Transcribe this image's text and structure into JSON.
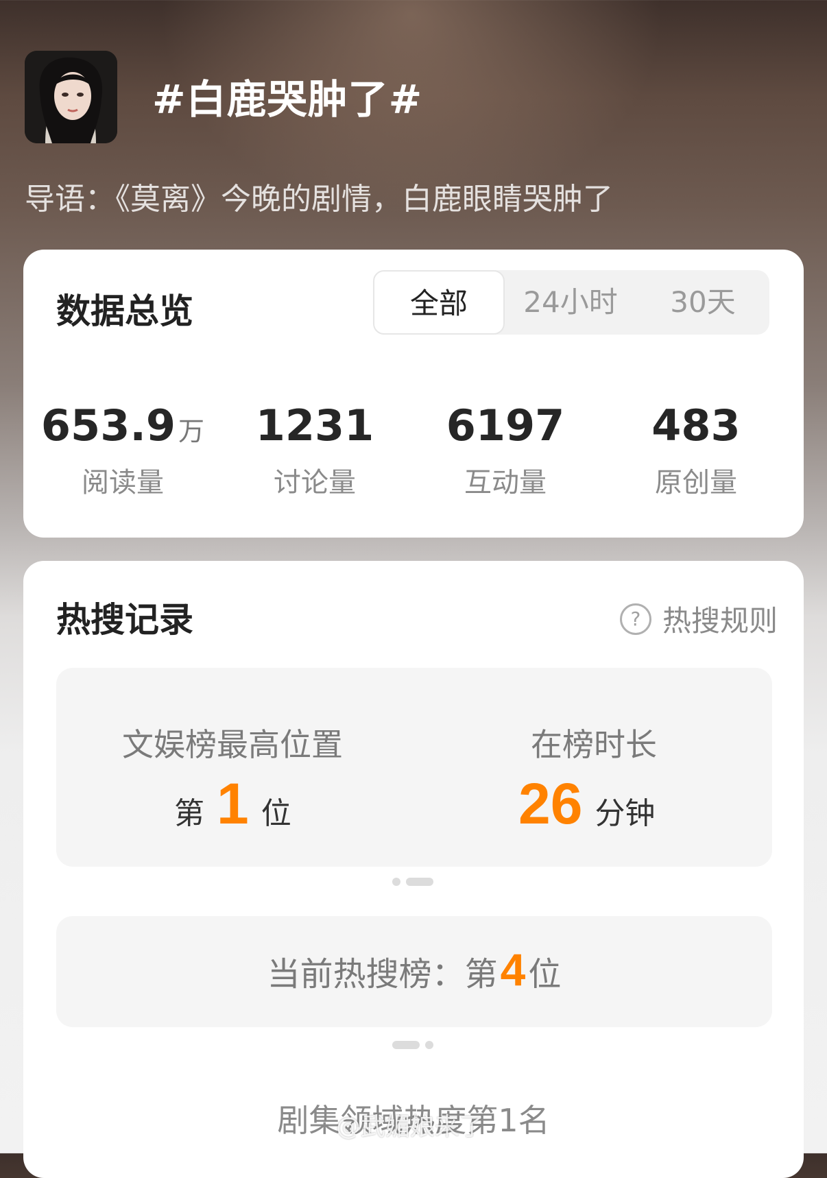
{
  "topic": {
    "title": "#白鹿哭肿了#",
    "intro": "导语：《莫离》今晚的剧情，白鹿眼睛哭肿了"
  },
  "overview": {
    "title": "数据总览",
    "tabs": [
      "全部",
      "24小时",
      "30天"
    ],
    "active_tab": "全部",
    "stats": [
      {
        "value": "653.9",
        "unit": "万",
        "label": "阅读量"
      },
      {
        "value": "1231",
        "unit": "",
        "label": "讨论量"
      },
      {
        "value": "6197",
        "unit": "",
        "label": "互动量"
      },
      {
        "value": "483",
        "unit": "",
        "label": "原创量"
      }
    ]
  },
  "hot_record": {
    "title": "热搜记录",
    "rules_label": "热搜规则",
    "rules_icon": "question-circle-icon",
    "peak": {
      "label": "文娱榜最高位置",
      "prefix": "第",
      "value": "1",
      "suffix": "位"
    },
    "duration": {
      "label": "在榜时长",
      "value": "26",
      "suffix": "分钟"
    },
    "current": {
      "label": "当前热搜榜：第",
      "value": "4",
      "suffix": "位"
    },
    "domain_rank": "剧集领域热度第1名"
  },
  "watermark": "@武媚娘来了",
  "colors": {
    "accent": "#ff8200",
    "card_bg": "#ffffff",
    "panel_bg": "#f5f5f5"
  }
}
